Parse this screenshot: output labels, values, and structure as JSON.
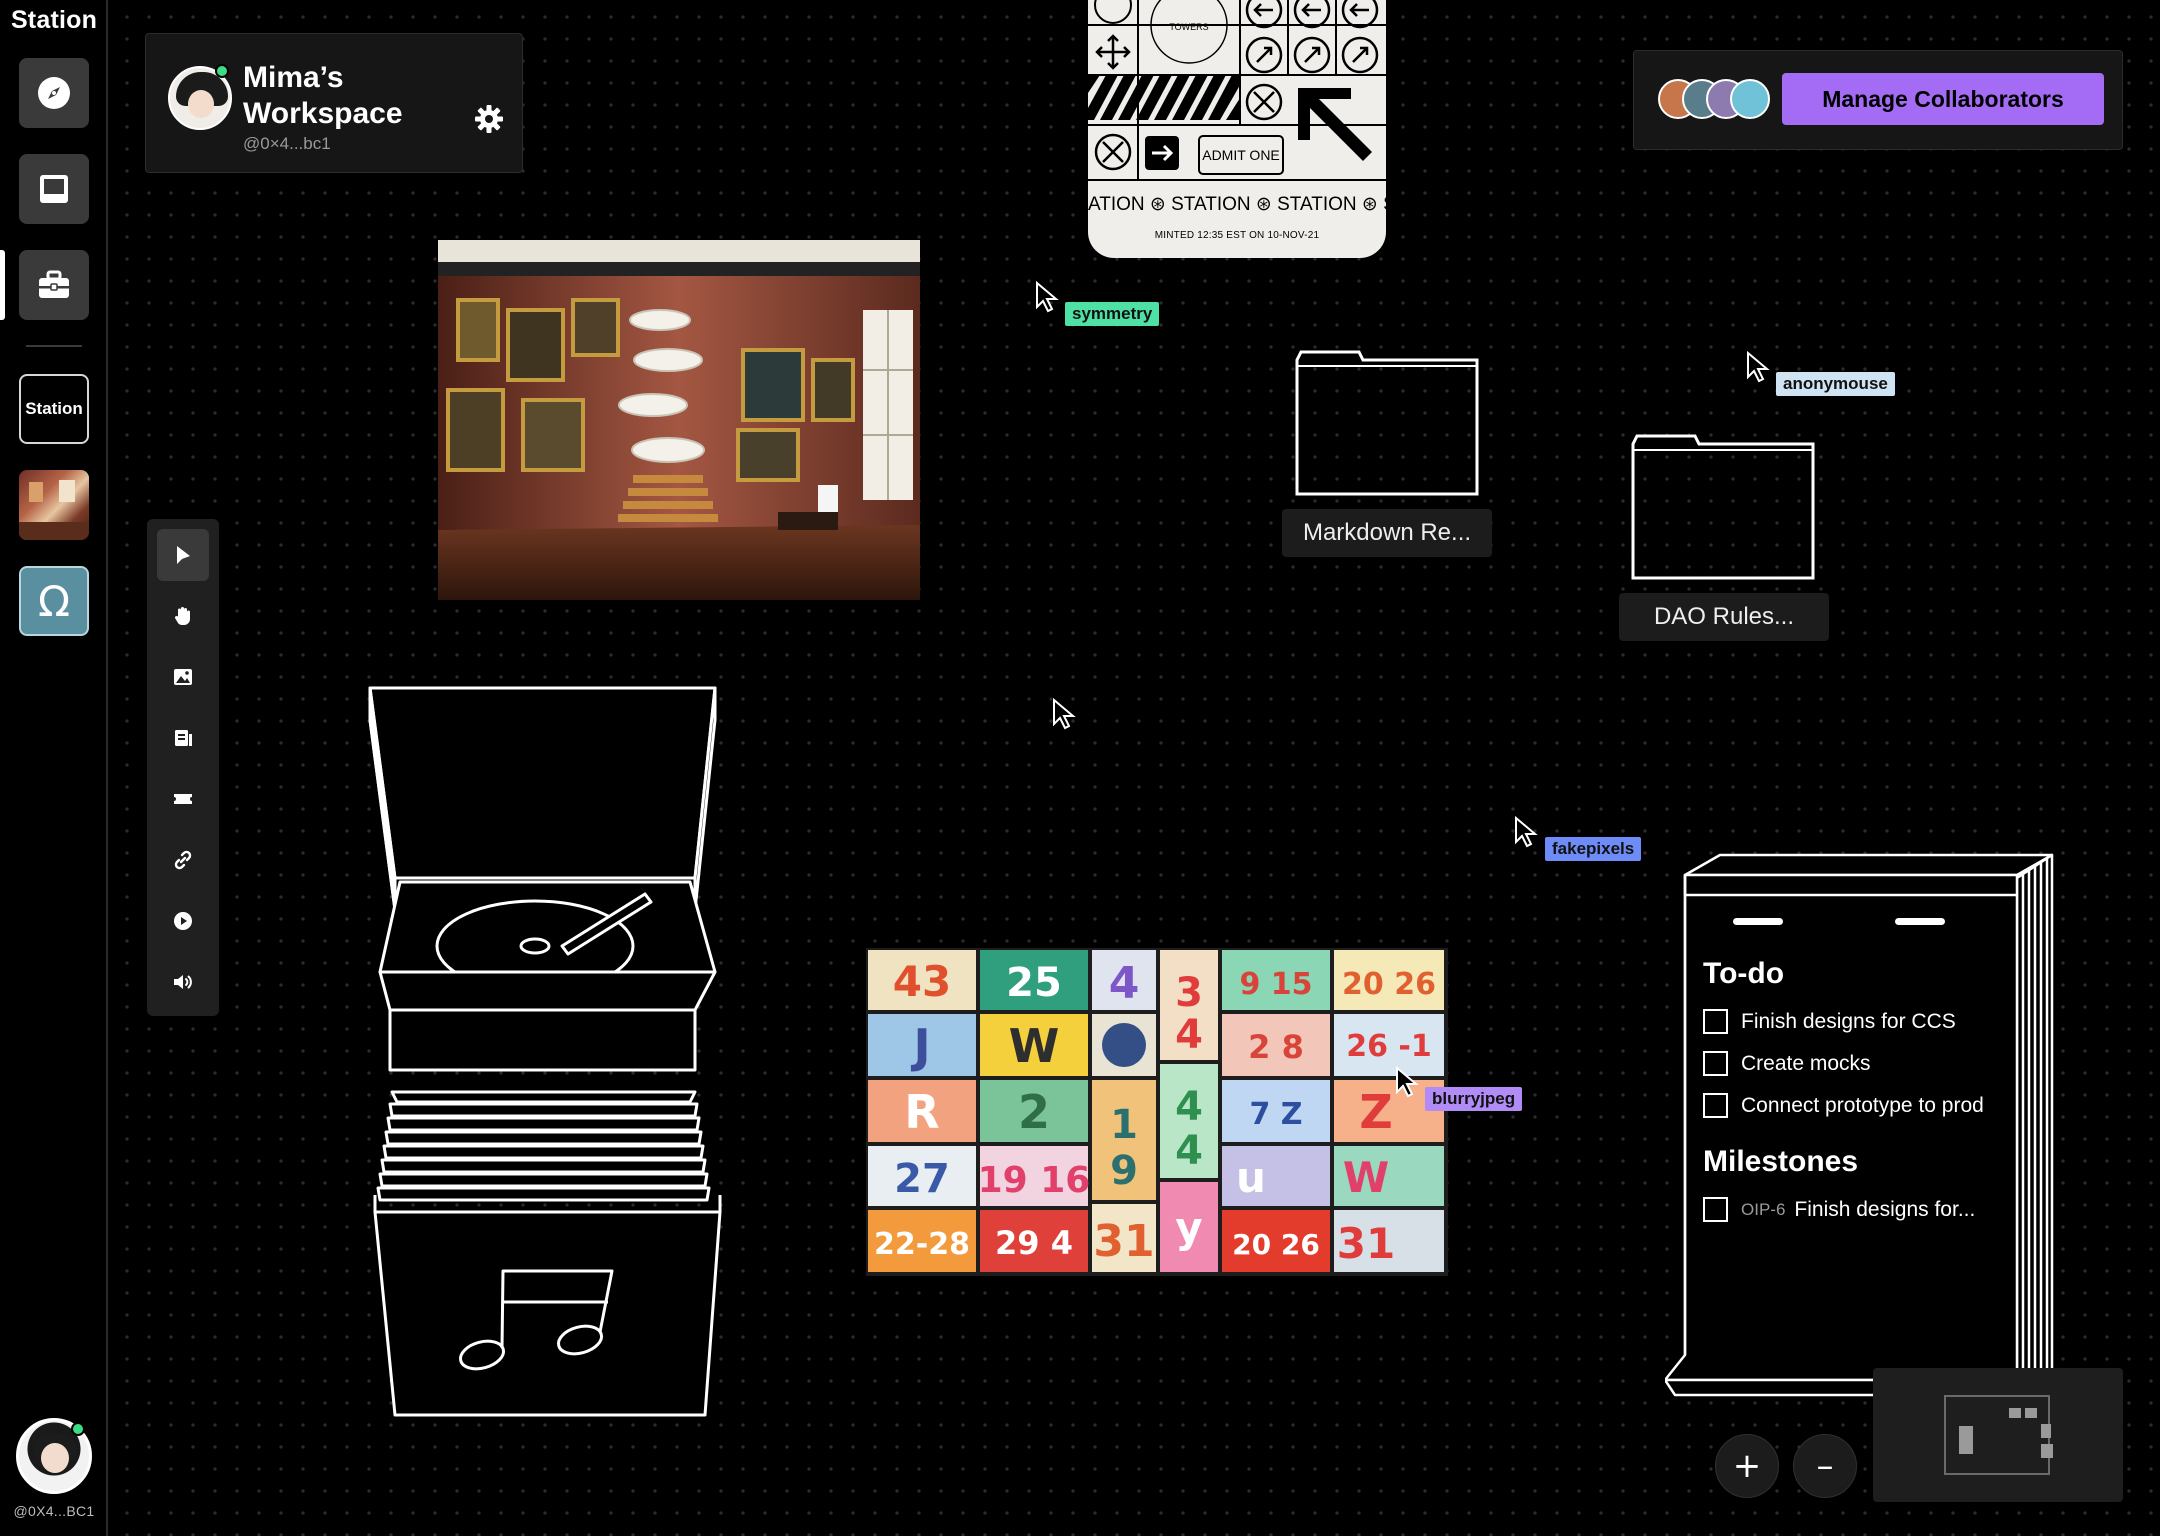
{
  "app": {
    "brand": "Station"
  },
  "sidebar": {
    "nav": [
      {
        "name": "explore",
        "icon": "compass-icon"
      },
      {
        "name": "inbox",
        "icon": "inbox-icon"
      },
      {
        "name": "work",
        "icon": "briefcase-icon"
      }
    ],
    "spaces": [
      {
        "label": "Station"
      },
      {
        "label": "",
        "icon": "gallery-thumbnail"
      },
      {
        "label": "",
        "icon": "omega-icon"
      }
    ],
    "user_handle": "@0X4...BC1"
  },
  "workspace": {
    "title": "Mima’s Workspace",
    "handle": "@0×4...bc1"
  },
  "collaborators": {
    "button_label": "Manage Collaborators",
    "avatars": [
      "#c7754a",
      "#5a7d8c",
      "#8d7bb0",
      "#6fc2d8"
    ]
  },
  "ticket": {
    "admit_label": "ADMIT ONE",
    "marquee": "ATION ⊛ STATION ⊛ STATION ⊛ STA",
    "minted": "MINTED 12:35 EST ON 10-NOV-21"
  },
  "cursors": [
    {
      "name": "symmetry",
      "color": "#4ee0a4"
    },
    {
      "name": "anonymouse",
      "color": "#cfe3f3"
    },
    {
      "name": "fakepixels",
      "color": "#6d8cf7"
    },
    {
      "name": "blurryjpeg",
      "color": "#b18cf7"
    }
  ],
  "folders": [
    {
      "label": "Markdown Re..."
    },
    {
      "label": "DAO Rules..."
    }
  ],
  "toolbar": {
    "tools": [
      "select-tool",
      "hand-tool",
      "image-tool",
      "document-tool",
      "ticket-tool",
      "link-tool",
      "play-tool",
      "audio-tool"
    ],
    "active": "select-tool"
  },
  "todo": {
    "heading": "To-do",
    "items": [
      {
        "label": "Finish designs for CCS",
        "checked": false
      },
      {
        "label": "Create mocks",
        "checked": false
      },
      {
        "label": "Connect prototype to prod",
        "checked": false
      }
    ],
    "milestones_heading": "Milestones",
    "milestones": [
      {
        "id": "OIP-6",
        "label": "Finish designs for...",
        "checked": false
      }
    ]
  },
  "zoom": {
    "in_label": "+",
    "out_label": "–"
  }
}
